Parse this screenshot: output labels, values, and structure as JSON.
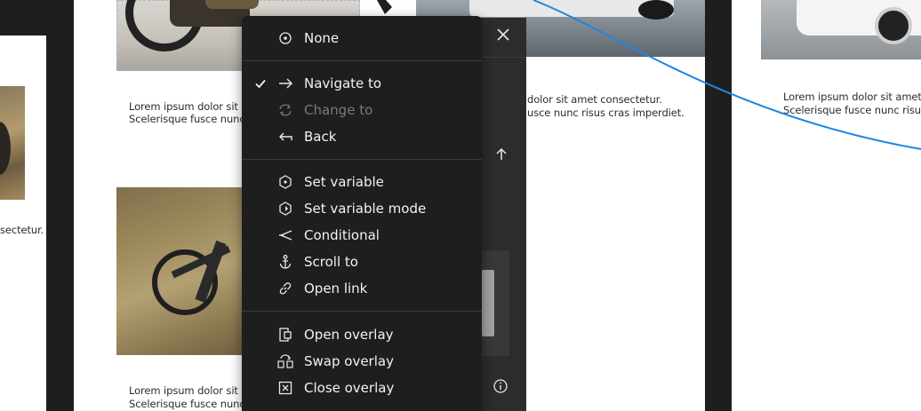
{
  "canvas": {
    "caption_text": {
      "line1": "Lorem ipsum dolor sit amet consectetur.",
      "line2": "Scelerisque fusce nunc risus cras imperdiet."
    },
    "left_caption_fragment": "sectetur.",
    "mid_caption_top": {
      "line1": "Lorem ipsum dolor sit a",
      "line2": "Scelerisque fusce nunc"
    },
    "mid_caption_bottom": {
      "line1": "Lorem ipsum dolor sit a",
      "line2": "Scelerisque fusce nunc"
    },
    "right_caption": {
      "line1": "dolor sit amet consectetur.",
      "line2": "usce nunc risus cras imperdiet."
    },
    "far_right_caption": {
      "line1": "Lorem ipsum dolor sit amet",
      "line2": "Scelerisque fusce nunc risu"
    },
    "connector_color": "#1a87e6",
    "selection_color": "#9db7d6"
  },
  "action_menu": {
    "items": [
      {
        "label": "None",
        "icon": "radio-target-icon",
        "checked": false,
        "disabled": false
      },
      {
        "label": "Navigate to",
        "icon": "arrow-right-icon",
        "checked": true,
        "disabled": false
      },
      {
        "label": "Change to",
        "icon": "swap-cycle-icon",
        "checked": false,
        "disabled": true
      },
      {
        "label": "Back",
        "icon": "arrow-back-icon",
        "checked": false,
        "disabled": false
      },
      {
        "label": "Set variable",
        "icon": "variable-hex-icon",
        "checked": false,
        "disabled": false
      },
      {
        "label": "Set variable mode",
        "icon": "variable-mode-icon",
        "checked": false,
        "disabled": false
      },
      {
        "label": "Conditional",
        "icon": "conditional-branch-icon",
        "checked": false,
        "disabled": false
      },
      {
        "label": "Scroll to",
        "icon": "anchor-icon",
        "checked": false,
        "disabled": false
      },
      {
        "label": "Open link",
        "icon": "link-icon",
        "checked": false,
        "disabled": false
      },
      {
        "label": "Open overlay",
        "icon": "open-overlay-icon",
        "checked": false,
        "disabled": false
      },
      {
        "label": "Swap overlay",
        "icon": "swap-overlay-icon",
        "checked": false,
        "disabled": false
      },
      {
        "label": "Close overlay",
        "icon": "close-overlay-icon",
        "checked": false,
        "disabled": false
      }
    ]
  },
  "side_panel": {
    "close_icon": "close-icon",
    "up_icon": "arrow-up-icon",
    "info_icon": "info-icon"
  }
}
